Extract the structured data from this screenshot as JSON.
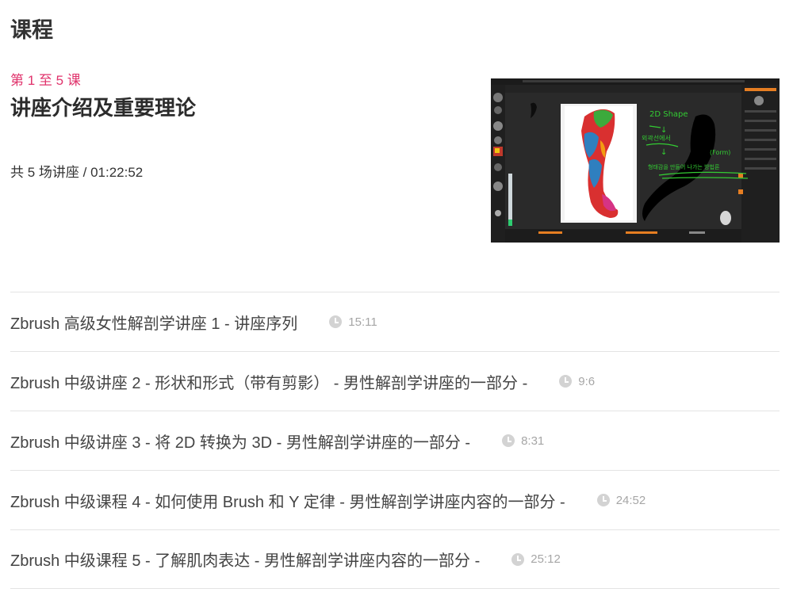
{
  "page": {
    "title": "课程"
  },
  "section": {
    "kicker": "第 1 至 5 课",
    "title": "讲座介绍及重要理论",
    "meta": "共 5 场讲座 / 01:22:52",
    "thumbnail": {
      "annotations": [
        "2D Shape",
        "↓",
        "외곽선에서",
        "↓",
        "(Form)",
        "형태감을 만들어 나가는 방법론"
      ]
    }
  },
  "lectures": [
    {
      "title": "Zbrush 高级女性解剖学讲座 1 - 讲座序列",
      "duration": "15:11"
    },
    {
      "title": "Zbrush 中级讲座 2 - 形状和形式（带有剪影） - 男性解剖学讲座的一部分 -",
      "duration": "9:6"
    },
    {
      "title": "Zbrush 中级讲座 3 - 将 2D 转换为 3D - 男性解剖学讲座的一部分 -",
      "duration": "8:31"
    },
    {
      "title": "Zbrush 中级课程 4 - 如何使用 Brush 和 Y 定律 - 男性解剖学讲座内容的一部分 -",
      "duration": "24:52"
    },
    {
      "title": "Zbrush 中级课程 5 - 了解肌肉表达 - 男性解剖学讲座内容的一部分 -",
      "duration": "25:12"
    }
  ],
  "colors": {
    "accent": "#e0336c",
    "annotation": "#33cc33"
  },
  "icons": {
    "duration": "clock-icon"
  }
}
